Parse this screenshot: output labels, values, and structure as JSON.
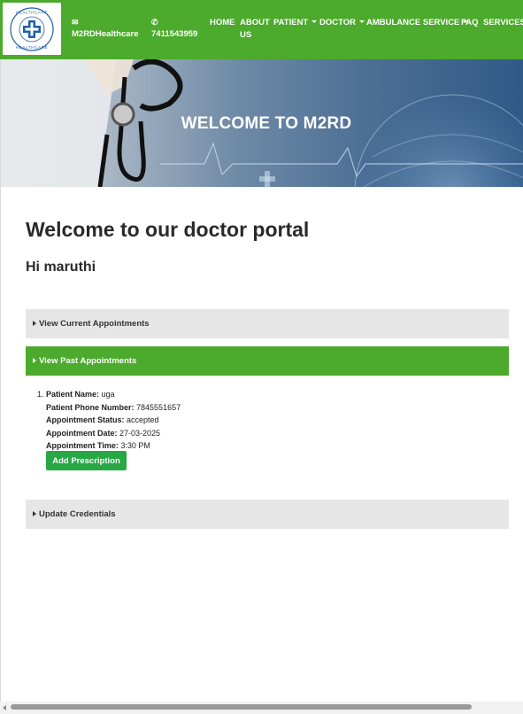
{
  "navbar": {
    "logo_alt": "HEALTHCARE",
    "email_icon": "envelope-icon",
    "email_text": "M2RDHealthcare",
    "phone_icon": "phone-icon",
    "phone_text": "7411543959",
    "items": [
      {
        "label": "HOME"
      },
      {
        "label_line1": "ABOUT",
        "label_line2": "US"
      },
      {
        "label": "PATIENT"
      },
      {
        "label": "DOCTOR"
      },
      {
        "label": "AMBULANCE SERVICE"
      },
      {
        "label": "FAQ"
      },
      {
        "label": "SERVICES"
      }
    ],
    "colors": {
      "bar": "#4caa2c"
    }
  },
  "hero": {
    "title": "WELCOME TO M2RD"
  },
  "content": {
    "heading": "Welcome to our doctor portal",
    "greeting": "Hi maruthi"
  },
  "panels": {
    "current": "View Current Appointments",
    "past": "View Past Appointments",
    "credentials": "Update Credentials"
  },
  "past_appointments": [
    {
      "number": "1.",
      "patient_name_label": "Patient Name:",
      "patient_name": "uga",
      "phone_label": "Patient Phone Number:",
      "phone": "7845551657",
      "status_label": "Appointment Status:",
      "status": "accepted",
      "date_label": "Appointment Date:",
      "date": "27-03-2025",
      "time_label": "Appointment Time:",
      "time": "3:30 PM",
      "action_label": "Add Prescription"
    }
  ]
}
